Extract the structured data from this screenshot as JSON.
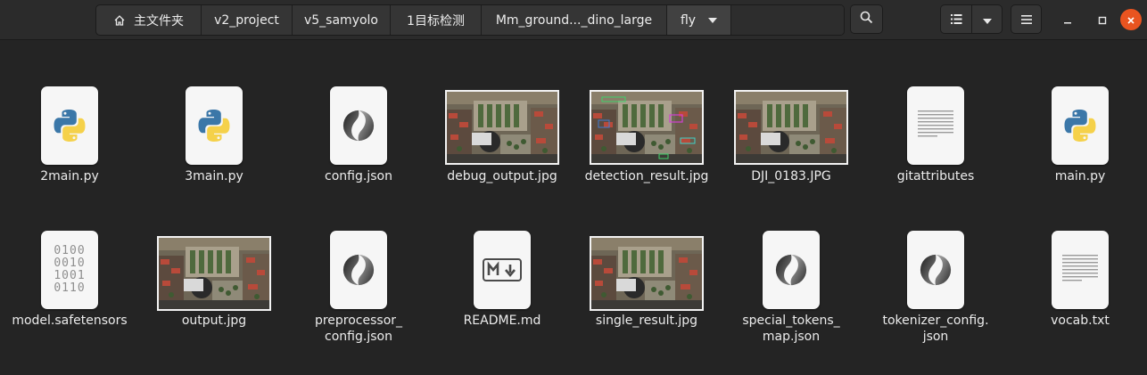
{
  "pathbar": {
    "crumbs": [
      "主文件夹",
      "v2_project",
      "v5_samyolo",
      "1目标检测",
      "Mm_ground..._dino_large",
      "fly"
    ]
  },
  "header": {
    "search_icon": "search-icon",
    "view_icon": "list-view-icon",
    "menu_icon": "hamburger-menu-icon"
  },
  "files": [
    {
      "name": "2main.py",
      "icon": "python-icon"
    },
    {
      "name": "3main.py",
      "icon": "python-icon"
    },
    {
      "name": "config.json",
      "icon": "json-icon"
    },
    {
      "name": "debug_output.jpg",
      "icon": "image-thumbnail"
    },
    {
      "name": "detection_result.jpg",
      "icon": "image-thumbnail"
    },
    {
      "name": "DJI_0183.JPG",
      "icon": "image-thumbnail"
    },
    {
      "name": "gitattributes",
      "icon": "text-icon"
    },
    {
      "name": "main.py",
      "icon": "python-icon"
    },
    {
      "name": "model.safetensors",
      "icon": "binary-icon"
    },
    {
      "name": "output.jpg",
      "icon": "image-thumbnail"
    },
    {
      "name_lines": [
        "preprocessor_",
        "config.json"
      ],
      "icon": "json-icon"
    },
    {
      "name": "README.md",
      "icon": "markdown-icon"
    },
    {
      "name": "single_result.jpg",
      "icon": "image-thumbnail"
    },
    {
      "name_lines": [
        "special_tokens_",
        "map.json"
      ],
      "icon": "json-icon"
    },
    {
      "name_lines": [
        "tokenizer_config.",
        "json"
      ],
      "icon": "json-icon"
    },
    {
      "name": "vocab.txt",
      "icon": "text-icon"
    }
  ],
  "binary_glyph_lines": [
    "0100",
    "0010",
    "1001",
    "0110"
  ],
  "colors": {
    "accent_close": "#e95420",
    "python_blue": "#3b77a8",
    "python_yellow": "#f5d14a"
  }
}
